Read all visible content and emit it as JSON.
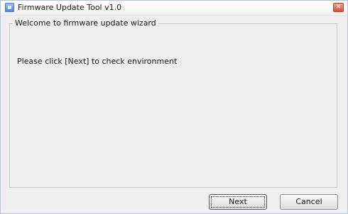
{
  "window": {
    "title": "Firmware Update Tool v1.0",
    "close_glyph": "✕",
    "app_icon": "app-icon"
  },
  "wizard": {
    "group_title": "Welcome to firmware update wizard",
    "message": "Please click [Next] to check environment"
  },
  "buttons": {
    "next_label": "Next",
    "cancel_label": "Cancel"
  }
}
